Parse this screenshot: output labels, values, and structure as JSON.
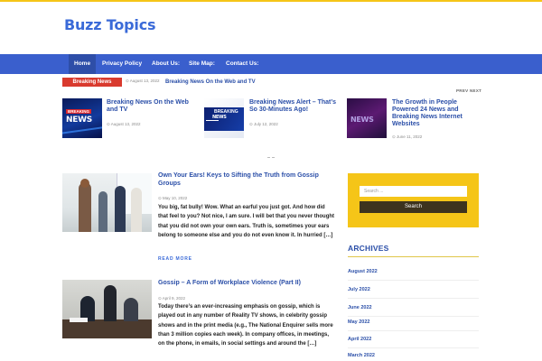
{
  "site": {
    "title": "Buzz Topics"
  },
  "nav": {
    "items": [
      {
        "label": "Home"
      },
      {
        "label": "Privacy Policy"
      },
      {
        "label": "About Us:"
      },
      {
        "label": "Site Map:"
      },
      {
        "label": "Contact Us:"
      }
    ]
  },
  "ticker": {
    "badge": "Breaking News",
    "date": "August 13, 2022",
    "title": "Breaking News On the Web and TV"
  },
  "slider": {
    "prev": "PREV",
    "next": "NEXT",
    "items": [
      {
        "title": "Breaking News On the Web and TV",
        "date": "August 13, 2022",
        "image_word_top": "BREAKING",
        "image_word_bottom": "NEWS"
      },
      {
        "title": "Breaking News Alert – That’s So 30-Minutes Ago!",
        "date": "July 12, 2022",
        "image_word_top": "BREAKING",
        "image_word_bottom": "NEWS"
      },
      {
        "title": "The Growth in People Powered 24 News and Breaking News Internet Websites",
        "date": "June 11, 2022",
        "image_word_top": "",
        "image_word_bottom": "NEWS"
      }
    ]
  },
  "posts": [
    {
      "title": "Own Your Ears! Keys to Sifting the Truth from Gossip Groups",
      "date": "May 10, 2022",
      "excerpt": "You big, fat bully! Wow. What an earful you just got. And how did that feel to you? Not nice, I am sure. I will bet that you never thought that you did not own your own ears. Truth is, sometimes your ears belong to someone else and you do not even know it. In hurried […]",
      "read_more": "READ MORE"
    },
    {
      "title": "Gossip – A Form of Workplace Violence (Part II)",
      "date": "April 9, 2022",
      "excerpt": "Today there’s an ever-increasing emphasis on gossip, which is played out in any number of Reality TV shows, in celebrity gossip shows and in the print media (e.g., The National Enquirer sells more than 3 million copies each week). In company offices, in meetings, on the phone, in emails, in social settings and around the […]"
    }
  ],
  "sidebar": {
    "search": {
      "placeholder": "Search ...",
      "button": "Search"
    },
    "archives": {
      "title": "ARCHIVES",
      "links": [
        "August 2022",
        "July 2022",
        "June 2022",
        "May 2022",
        "April 2022",
        "March 2022"
      ]
    }
  },
  "colors": {
    "accent_yellow": "#f5c518",
    "nav_blue": "#3a5fcd",
    "link_blue": "#2b4fa8",
    "ticker_red": "#d93a2e"
  }
}
